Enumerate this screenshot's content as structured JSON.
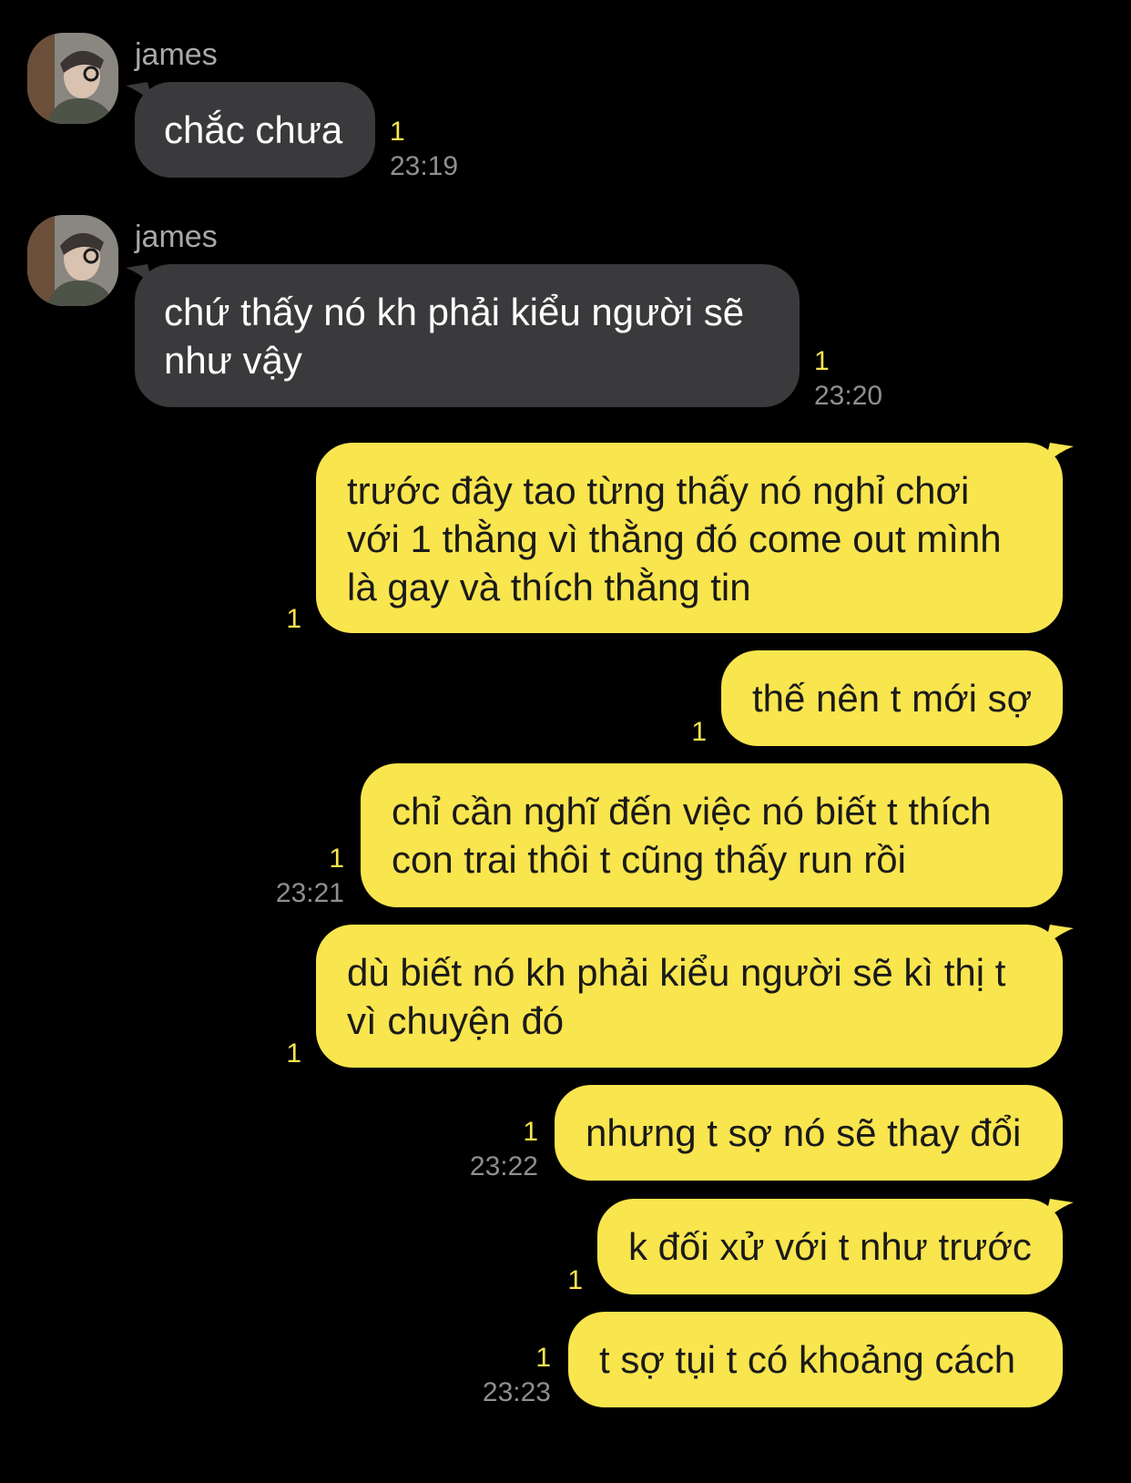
{
  "conversation": {
    "messages": [
      {
        "sender": "james",
        "direction": "incoming",
        "lines": [
          "chắc chưa"
        ],
        "unread": "1",
        "time": "23:19"
      },
      {
        "sender": "james",
        "direction": "incoming",
        "lines": [
          "chứ thấy nó kh phải kiểu người sẽ",
          "như vậy"
        ],
        "unread": "1",
        "time": "23:20"
      },
      {
        "direction": "outgoing",
        "lines": [
          "trước đây tao từng thấy nó nghỉ chơi",
          "với 1 thằng vì thằng đó come out mình",
          "là gay và thích thằng tin"
        ],
        "unread": "1",
        "time": ""
      },
      {
        "direction": "outgoing",
        "lines": [
          "thế nên t mới sợ"
        ],
        "unread": "1",
        "time": ""
      },
      {
        "direction": "outgoing",
        "lines": [
          "chỉ cần nghĩ đến việc nó biết t thích",
          "con trai thôi t cũng thấy run rồi"
        ],
        "unread": "1",
        "time": "23:21"
      },
      {
        "direction": "outgoing",
        "lines": [
          "dù biết nó kh phải kiểu người sẽ kì thị t",
          "vì chuyện đó"
        ],
        "unread": "1",
        "time": ""
      },
      {
        "direction": "outgoing",
        "lines": [
          "nhưng t sợ nó sẽ thay đổi"
        ],
        "unread": "1",
        "time": "23:22"
      },
      {
        "direction": "outgoing",
        "lines": [
          "k đối xử với t như trước"
        ],
        "unread": "1",
        "time": ""
      },
      {
        "direction": "outgoing",
        "lines": [
          "t sợ tụi t có khoảng cách"
        ],
        "unread": "1",
        "time": "23:23"
      }
    ]
  },
  "colors": {
    "background": "#000000",
    "incoming_bubble": "#3a3a3c",
    "outgoing_bubble": "#f9e54e",
    "unread_count": "#f9e54e",
    "timestamp": "#8e8e93",
    "sender_name": "#a8a8a8"
  },
  "icons": {
    "avatar": "person-profile-photo-avatar"
  }
}
